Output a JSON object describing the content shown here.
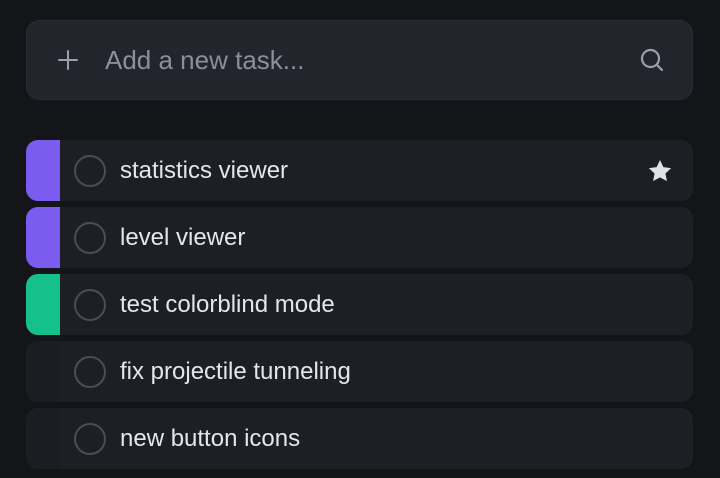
{
  "add_task": {
    "placeholder": "Add a new task...",
    "plus_icon": "plus-icon",
    "search_icon": "search-icon"
  },
  "tasks": [
    {
      "label": "statistics viewer",
      "color": "#7c5cf0",
      "starred": true
    },
    {
      "label": "level viewer",
      "color": "#7c5cf0",
      "starred": false
    },
    {
      "label": "test colorblind mode",
      "color": "#16c08a",
      "starred": false
    },
    {
      "label": "fix projectile tunneling",
      "color": "",
      "starred": false
    },
    {
      "label": "new button icons",
      "color": "",
      "starred": false
    }
  ],
  "colors": {
    "background": "#141519",
    "card": "#1e1f24",
    "purple_tag": "#7c5cf0",
    "green_tag": "#16c08a",
    "star": "#e0e2e8"
  }
}
